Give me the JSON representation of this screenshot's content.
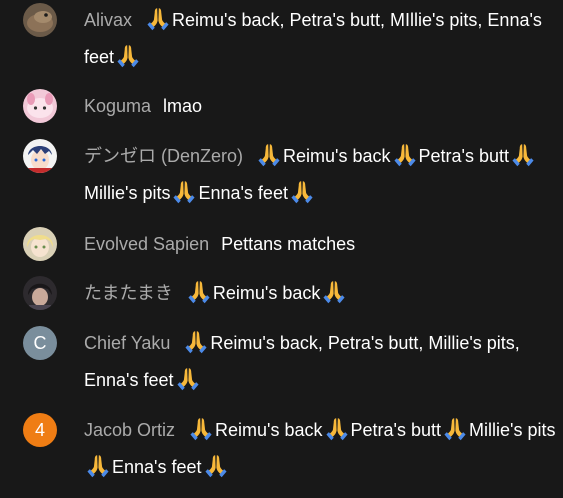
{
  "colors": {
    "background": "#181818",
    "author": "#aaaaaa",
    "message": "#ffffff",
    "pray_skin": "#f7b83a",
    "pray_sleeve": "#4c8ae8"
  },
  "messages": [
    {
      "author": "Alivax",
      "avatar": {
        "kind": "image",
        "icon": "lizard-avatar-icon"
      },
      "parts": [
        {
          "pray": true
        },
        {
          "text": "Reimu's back, Petra's butt, MIllie's pits, Enna's feet"
        },
        {
          "pray": true
        }
      ]
    },
    {
      "author": "Koguma",
      "avatar": {
        "kind": "image",
        "icon": "pink-character-avatar-icon"
      },
      "parts": [
        {
          "text": "lmao"
        }
      ]
    },
    {
      "author": "デンゼロ (DenZero)",
      "avatar": {
        "kind": "image",
        "icon": "anime-boy-avatar-icon"
      },
      "parts": [
        {
          "pray": true
        },
        {
          "text": "Reimu's back"
        },
        {
          "pray": true
        },
        {
          "text": "Petra's butt"
        },
        {
          "pray": true
        },
        {
          "text": "Millie's pits"
        },
        {
          "pray": true
        },
        {
          "text": "Enna's feet"
        },
        {
          "pray": true
        }
      ]
    },
    {
      "author": "Evolved Sapien",
      "avatar": {
        "kind": "image",
        "icon": "blonde-anime-avatar-icon"
      },
      "parts": [
        {
          "text": "Pettans matches"
        }
      ]
    },
    {
      "author": "たまたまき",
      "avatar": {
        "kind": "image",
        "icon": "dark-anime-avatar-icon"
      },
      "parts": [
        {
          "pray": true
        },
        {
          "text": "Reimu's back"
        },
        {
          "pray": true
        }
      ]
    },
    {
      "author": "Chief Yaku",
      "avatar": {
        "kind": "letter",
        "letter": "C",
        "color": "#7a8e9c"
      },
      "parts": [
        {
          "pray": true
        },
        {
          "text": "Reimu's back, Petra's butt, Millie's pits, Enna's feet"
        },
        {
          "pray": true
        }
      ]
    },
    {
      "author": "Jacob Ortiz",
      "avatar": {
        "kind": "letter",
        "letter": "4",
        "color": "#ef7d14"
      },
      "parts": [
        {
          "pray": true
        },
        {
          "text": "Reimu's back"
        },
        {
          "pray": true
        },
        {
          "text": "Petra's butt"
        },
        {
          "pray": true
        },
        {
          "text": "Millie's pits"
        },
        {
          "pray": true
        },
        {
          "text": "Enna's feet"
        },
        {
          "pray": true
        }
      ]
    }
  ]
}
